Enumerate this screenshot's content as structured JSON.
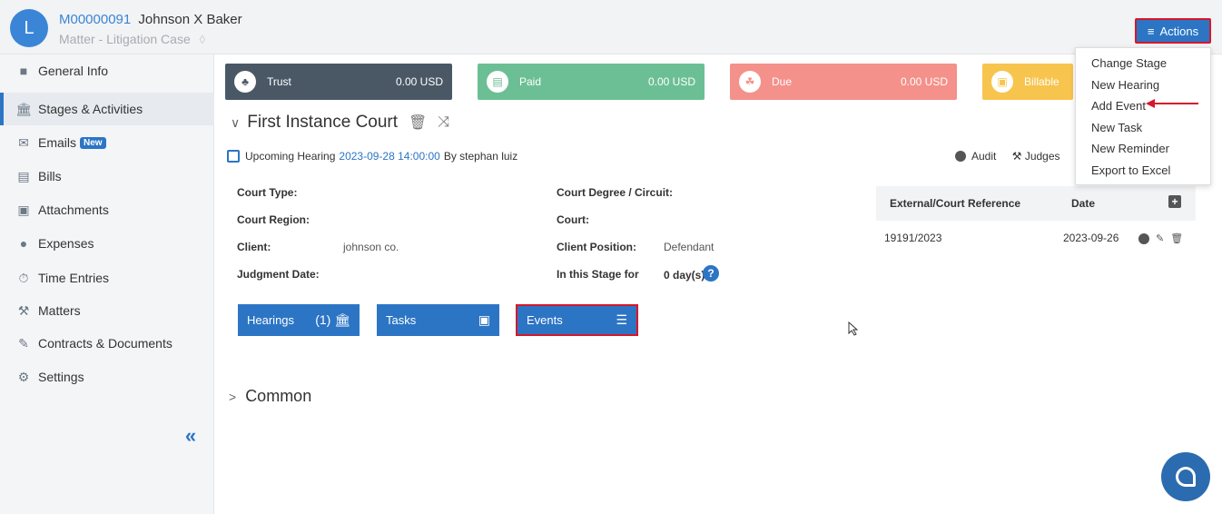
{
  "header": {
    "avatar_letter": "L",
    "matter_id": "M00000091",
    "matter_name": "Johnson X Baker",
    "matter_type": "Matter - Litigation Case",
    "actions_label": "Actions"
  },
  "sidebar": {
    "items": [
      {
        "label": "General Info",
        "icon": "briefcase-icon"
      },
      {
        "label": "Stages & Activities",
        "icon": "bank-icon"
      },
      {
        "label": "Emails",
        "icon": "envelope-icon",
        "badge": "New"
      },
      {
        "label": "Bills",
        "icon": "bill-icon"
      },
      {
        "label": "Attachments",
        "icon": "folder-icon"
      },
      {
        "label": "Expenses",
        "icon": "coin-icon"
      },
      {
        "label": "Time Entries",
        "icon": "stopwatch-icon"
      },
      {
        "label": "Matters",
        "icon": "gavel-icon"
      },
      {
        "label": "Contracts & Documents",
        "icon": "document-edit-icon"
      },
      {
        "label": "Settings",
        "icon": "gear-icon"
      }
    ],
    "collapse_glyph": "«"
  },
  "cards": [
    {
      "label": "Trust",
      "amount": "0.00 USD",
      "color": "#4a5866"
    },
    {
      "label": "Paid",
      "amount": "0.00 USD",
      "color": "#6cbf95"
    },
    {
      "label": "Due",
      "amount": "0.00 USD",
      "color": "#f4918a"
    },
    {
      "label": "Billable",
      "amount": "",
      "color": "#f7c44e"
    }
  ],
  "stage": {
    "title": "First Instance Court",
    "hearing_prefix": "Upcoming Hearing",
    "hearing_date": "2023-09-28 14:00:00",
    "hearing_suffix": "By stephan luiz",
    "audit_label": "Audit",
    "judges_label": "Judges"
  },
  "fields": {
    "court_type_label": "Court Type:",
    "court_degree_label": "Court Degree / Circuit:",
    "court_region_label": "Court Region:",
    "court_label": "Court:",
    "client_label": "Client:",
    "client_value": "johnson co.",
    "client_position_label": "Client Position:",
    "client_position_value": "Defendant",
    "judgment_date_label": "Judgment Date:",
    "in_stage_label": "In this Stage for",
    "in_stage_value": "0 day(s)"
  },
  "buttons": {
    "hearings_label": "Hearings",
    "hearings_count": "(1)",
    "tasks_label": "Tasks",
    "events_label": "Events"
  },
  "common_label": "Common",
  "references": {
    "col_ref": "External/Court Reference",
    "col_date": "Date",
    "rows": [
      {
        "ref": "19191/2023",
        "date": "2023-09-26"
      }
    ]
  },
  "actions_menu": {
    "items": [
      "Change Stage",
      "New Hearing",
      "Add Event",
      "New Task",
      "New Reminder",
      "Export to Excel"
    ]
  }
}
